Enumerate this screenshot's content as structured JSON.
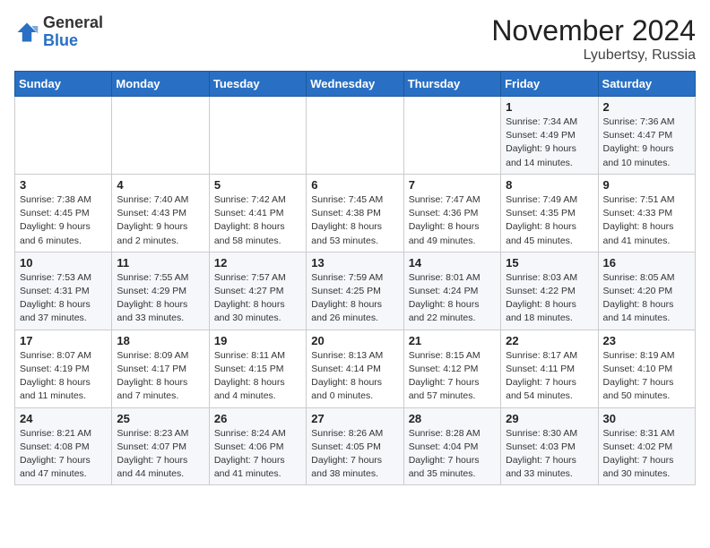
{
  "logo": {
    "general": "General",
    "blue": "Blue"
  },
  "title": "November 2024",
  "location": "Lyubertsy, Russia",
  "days_of_week": [
    "Sunday",
    "Monday",
    "Tuesday",
    "Wednesday",
    "Thursday",
    "Friday",
    "Saturday"
  ],
  "weeks": [
    [
      {
        "day": "",
        "info": ""
      },
      {
        "day": "",
        "info": ""
      },
      {
        "day": "",
        "info": ""
      },
      {
        "day": "",
        "info": ""
      },
      {
        "day": "",
        "info": ""
      },
      {
        "day": "1",
        "info": "Sunrise: 7:34 AM\nSunset: 4:49 PM\nDaylight: 9 hours and 14 minutes."
      },
      {
        "day": "2",
        "info": "Sunrise: 7:36 AM\nSunset: 4:47 PM\nDaylight: 9 hours and 10 minutes."
      }
    ],
    [
      {
        "day": "3",
        "info": "Sunrise: 7:38 AM\nSunset: 4:45 PM\nDaylight: 9 hours and 6 minutes."
      },
      {
        "day": "4",
        "info": "Sunrise: 7:40 AM\nSunset: 4:43 PM\nDaylight: 9 hours and 2 minutes."
      },
      {
        "day": "5",
        "info": "Sunrise: 7:42 AM\nSunset: 4:41 PM\nDaylight: 8 hours and 58 minutes."
      },
      {
        "day": "6",
        "info": "Sunrise: 7:45 AM\nSunset: 4:38 PM\nDaylight: 8 hours and 53 minutes."
      },
      {
        "day": "7",
        "info": "Sunrise: 7:47 AM\nSunset: 4:36 PM\nDaylight: 8 hours and 49 minutes."
      },
      {
        "day": "8",
        "info": "Sunrise: 7:49 AM\nSunset: 4:35 PM\nDaylight: 8 hours and 45 minutes."
      },
      {
        "day": "9",
        "info": "Sunrise: 7:51 AM\nSunset: 4:33 PM\nDaylight: 8 hours and 41 minutes."
      }
    ],
    [
      {
        "day": "10",
        "info": "Sunrise: 7:53 AM\nSunset: 4:31 PM\nDaylight: 8 hours and 37 minutes."
      },
      {
        "day": "11",
        "info": "Sunrise: 7:55 AM\nSunset: 4:29 PM\nDaylight: 8 hours and 33 minutes."
      },
      {
        "day": "12",
        "info": "Sunrise: 7:57 AM\nSunset: 4:27 PM\nDaylight: 8 hours and 30 minutes."
      },
      {
        "day": "13",
        "info": "Sunrise: 7:59 AM\nSunset: 4:25 PM\nDaylight: 8 hours and 26 minutes."
      },
      {
        "day": "14",
        "info": "Sunrise: 8:01 AM\nSunset: 4:24 PM\nDaylight: 8 hours and 22 minutes."
      },
      {
        "day": "15",
        "info": "Sunrise: 8:03 AM\nSunset: 4:22 PM\nDaylight: 8 hours and 18 minutes."
      },
      {
        "day": "16",
        "info": "Sunrise: 8:05 AM\nSunset: 4:20 PM\nDaylight: 8 hours and 14 minutes."
      }
    ],
    [
      {
        "day": "17",
        "info": "Sunrise: 8:07 AM\nSunset: 4:19 PM\nDaylight: 8 hours and 11 minutes."
      },
      {
        "day": "18",
        "info": "Sunrise: 8:09 AM\nSunset: 4:17 PM\nDaylight: 8 hours and 7 minutes."
      },
      {
        "day": "19",
        "info": "Sunrise: 8:11 AM\nSunset: 4:15 PM\nDaylight: 8 hours and 4 minutes."
      },
      {
        "day": "20",
        "info": "Sunrise: 8:13 AM\nSunset: 4:14 PM\nDaylight: 8 hours and 0 minutes."
      },
      {
        "day": "21",
        "info": "Sunrise: 8:15 AM\nSunset: 4:12 PM\nDaylight: 7 hours and 57 minutes."
      },
      {
        "day": "22",
        "info": "Sunrise: 8:17 AM\nSunset: 4:11 PM\nDaylight: 7 hours and 54 minutes."
      },
      {
        "day": "23",
        "info": "Sunrise: 8:19 AM\nSunset: 4:10 PM\nDaylight: 7 hours and 50 minutes."
      }
    ],
    [
      {
        "day": "24",
        "info": "Sunrise: 8:21 AM\nSunset: 4:08 PM\nDaylight: 7 hours and 47 minutes."
      },
      {
        "day": "25",
        "info": "Sunrise: 8:23 AM\nSunset: 4:07 PM\nDaylight: 7 hours and 44 minutes."
      },
      {
        "day": "26",
        "info": "Sunrise: 8:24 AM\nSunset: 4:06 PM\nDaylight: 7 hours and 41 minutes."
      },
      {
        "day": "27",
        "info": "Sunrise: 8:26 AM\nSunset: 4:05 PM\nDaylight: 7 hours and 38 minutes."
      },
      {
        "day": "28",
        "info": "Sunrise: 8:28 AM\nSunset: 4:04 PM\nDaylight: 7 hours and 35 minutes."
      },
      {
        "day": "29",
        "info": "Sunrise: 8:30 AM\nSunset: 4:03 PM\nDaylight: 7 hours and 33 minutes."
      },
      {
        "day": "30",
        "info": "Sunrise: 8:31 AM\nSunset: 4:02 PM\nDaylight: 7 hours and 30 minutes."
      }
    ]
  ]
}
